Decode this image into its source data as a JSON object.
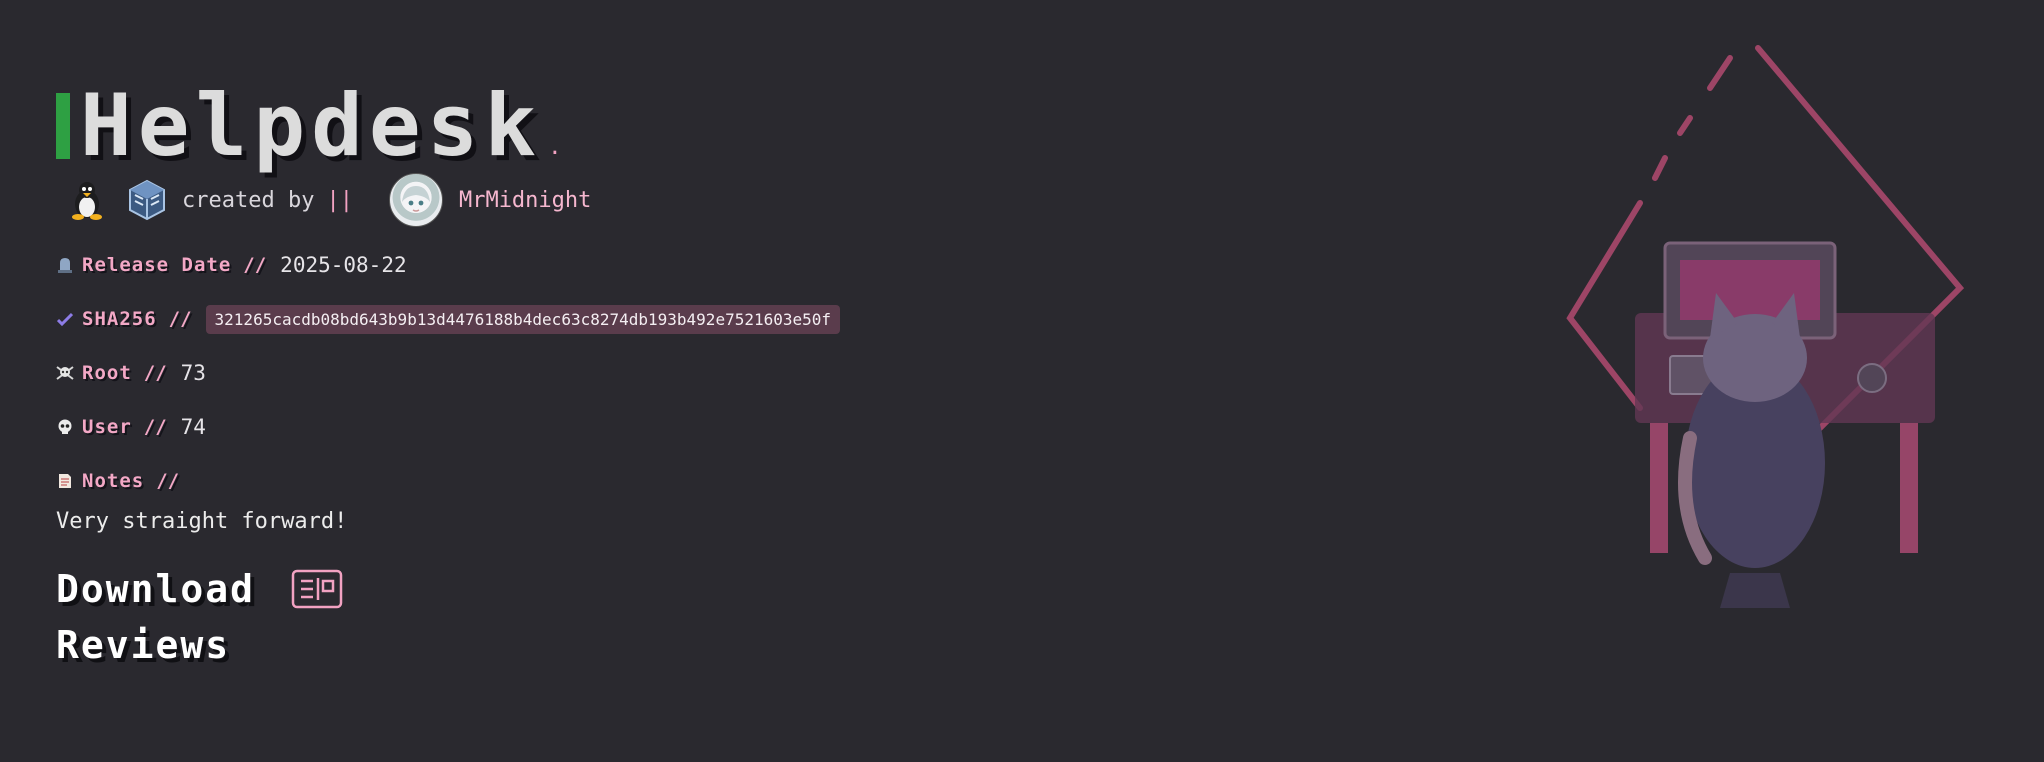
{
  "header": {
    "title": "Helpdesk",
    "title_dot": ".",
    "accent_color": "#2ea043"
  },
  "creator": {
    "os_icon": "linux-penguin-icon",
    "vm_icon": "virtualbox-icon",
    "created_by_label": "created by",
    "separator": "||",
    "author": "MrMidnight"
  },
  "info": {
    "release_date": {
      "label": "Release Date",
      "slashes": "//",
      "value": "2025-08-22",
      "icon": "tombstone-icon"
    },
    "sha256": {
      "label": "SHA256",
      "slashes": "//",
      "value": "321265cacdb08bd643b9b13d4476188b4dec63c8274db193b492e7521603e50f",
      "icon": "checkmark-icon"
    },
    "root": {
      "label": "Root",
      "slashes": "//",
      "value": "73",
      "icon": "skull-crossbones-icon"
    },
    "user": {
      "label": "User",
      "slashes": "//",
      "value": "74",
      "icon": "skull-icon"
    },
    "notes": {
      "label": "Notes",
      "slashes": "//",
      "text": "Very straight forward!",
      "icon": "note-icon"
    }
  },
  "actions": {
    "download": "Download",
    "reviews": "Reviews"
  },
  "colors": {
    "background": "#2a292f",
    "label_pink": "#f3a8c6",
    "hash_bg": "#5a3c4c"
  }
}
